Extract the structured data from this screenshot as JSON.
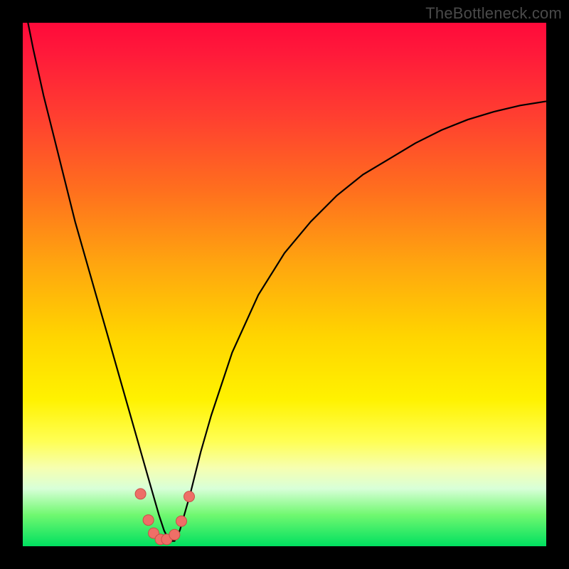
{
  "watermark": "TheBottleneck.com",
  "colors": {
    "page_bg": "#000000",
    "curve": "#000000",
    "marker_fill": "#ee6f67",
    "marker_stroke": "#c94f48"
  },
  "chart_data": {
    "type": "line",
    "title": "",
    "xlabel": "",
    "ylabel": "",
    "xlim": [
      0,
      100
    ],
    "ylim": [
      0,
      100
    ],
    "grid": false,
    "series": [
      {
        "name": "bottleneck-curve",
        "x": [
          0,
          2,
          4,
          6,
          8,
          10,
          12,
          14,
          16,
          18,
          20,
          22,
          24,
          26,
          27,
          28,
          29,
          30,
          32,
          34,
          36,
          40,
          45,
          50,
          55,
          60,
          65,
          70,
          75,
          80,
          85,
          90,
          95,
          100
        ],
        "y": [
          105,
          95,
          86,
          78,
          70,
          62,
          55,
          48,
          41,
          34,
          27,
          20,
          13,
          6,
          3,
          1,
          1,
          3,
          10,
          18,
          25,
          37,
          48,
          56,
          62,
          67,
          71,
          74,
          77,
          79.5,
          81.5,
          83,
          84.2,
          85
        ]
      }
    ],
    "markers": {
      "name": "highlight-points",
      "x": [
        22.5,
        24.0,
        25.0,
        26.3,
        27.5,
        29.0,
        30.3,
        31.8
      ],
      "y": [
        10.0,
        5.0,
        2.5,
        1.3,
        1.3,
        2.2,
        4.8,
        9.5
      ]
    }
  }
}
